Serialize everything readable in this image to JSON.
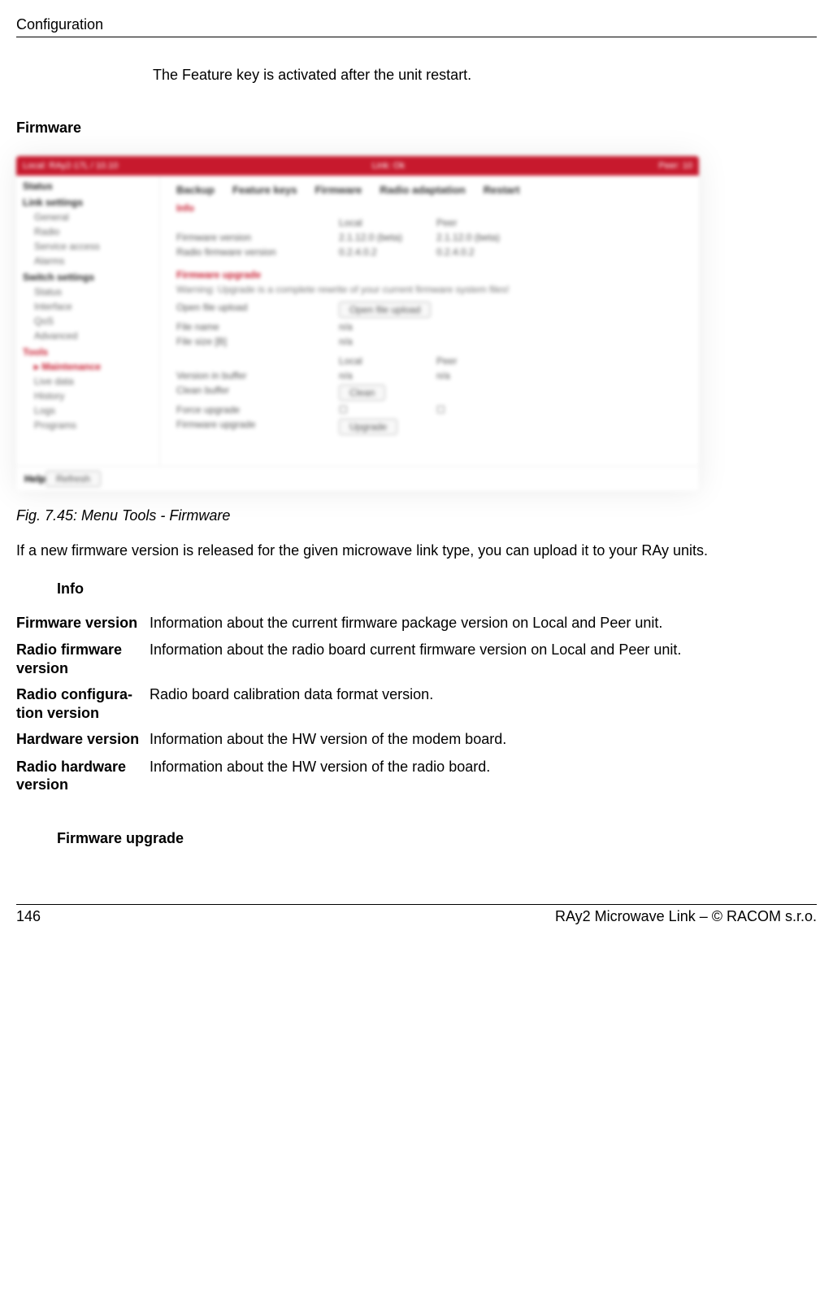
{
  "header": {
    "title": "Configuration"
  },
  "intro": "The Feature key is activated after the unit restart.",
  "section": {
    "firmware": "Firmware"
  },
  "screenshot": {
    "topbar": {
      "left": "Local: RAy2-17L / 10.10",
      "mid": "Link: Ok",
      "right": "Peer: 10"
    },
    "nav": {
      "status": "Status",
      "link_settings": "Link settings",
      "general": "General",
      "radio": "Radio",
      "service_access": "Service access",
      "alarms": "Alarms",
      "switch_settings": "Switch settings",
      "sw_status": "Status",
      "interface": "Interface",
      "qos": "QoS",
      "advanced": "Advanced",
      "tools": "Tools",
      "maintenance": "Maintenance",
      "live_data": "Live data",
      "history": "History",
      "logs": "Logs",
      "programs": "Programs",
      "help": "Help"
    },
    "tabs": {
      "backup": "Backup",
      "feature_keys": "Feature keys",
      "firmware": "Firmware",
      "radio_adaptation": "Radio adaptation",
      "restart": "Restart"
    },
    "info": {
      "title": "Info",
      "local": "Local",
      "peer": "Peer",
      "fw_version_label": "Firmware version",
      "fw_version_local": "2.1.12.0 (beta)",
      "fw_version_peer": "2.1.12.0 (beta)",
      "radio_fw_label": "Radio firmware version",
      "radio_fw_local": "0.2.4.0.2",
      "radio_fw_peer": "0.2.4.0.2"
    },
    "upgrade": {
      "title": "Firmware upgrade",
      "warning": "Warning: Upgrade is a complete rewrite of your current firmware system files!",
      "open_label": "Open file upload",
      "open_button": "Open file upload",
      "file_name_label": "File name",
      "file_name_value": "n/a",
      "file_size_label": "File size [B]",
      "file_size_value": "n/a",
      "col_local": "Local",
      "col_peer": "Peer",
      "ver_in_buffer_label": "Version in buffer",
      "ver_in_buffer_local": "n/a",
      "ver_in_buffer_peer": "n/a",
      "clean_buffer_label": "Clean buffer",
      "clean_button": "Clean",
      "force_label": "Force upgrade",
      "fw_upgrade_label": "Firmware upgrade",
      "upgrade_button": "Upgrade"
    },
    "refresh": "Refresh"
  },
  "figure_caption": "Fig. 7.45: Menu Tools - Firmware",
  "body_para": "If a new firmware version is released for the given microwave link type, you can upload it to your RAy units.",
  "defs": {
    "info_title": "Info",
    "firmware_version": {
      "term": "Firmware version",
      "desc": "Information about the current firmware package version on Local and Peer unit."
    },
    "radio_fw_version": {
      "term": "Radio firmware version",
      "desc": "Information about the radio board current firmware version on Local and Peer unit."
    },
    "radio_config_version": {
      "term": "Radio configura­tion version",
      "desc": "Radio board calibration data format version."
    },
    "hardware_version": {
      "term": "Hardware version",
      "desc": "Information about the HW version of the modem board."
    },
    "radio_hw_version": {
      "term": "Radio hardware version",
      "desc": "Information about the HW version of the radio board."
    },
    "fw_upgrade_title": "Firmware upgrade"
  },
  "footer": {
    "page_no": "146",
    "copyright": "RAy2 Microwave Link – © RACOM s.r.o."
  }
}
